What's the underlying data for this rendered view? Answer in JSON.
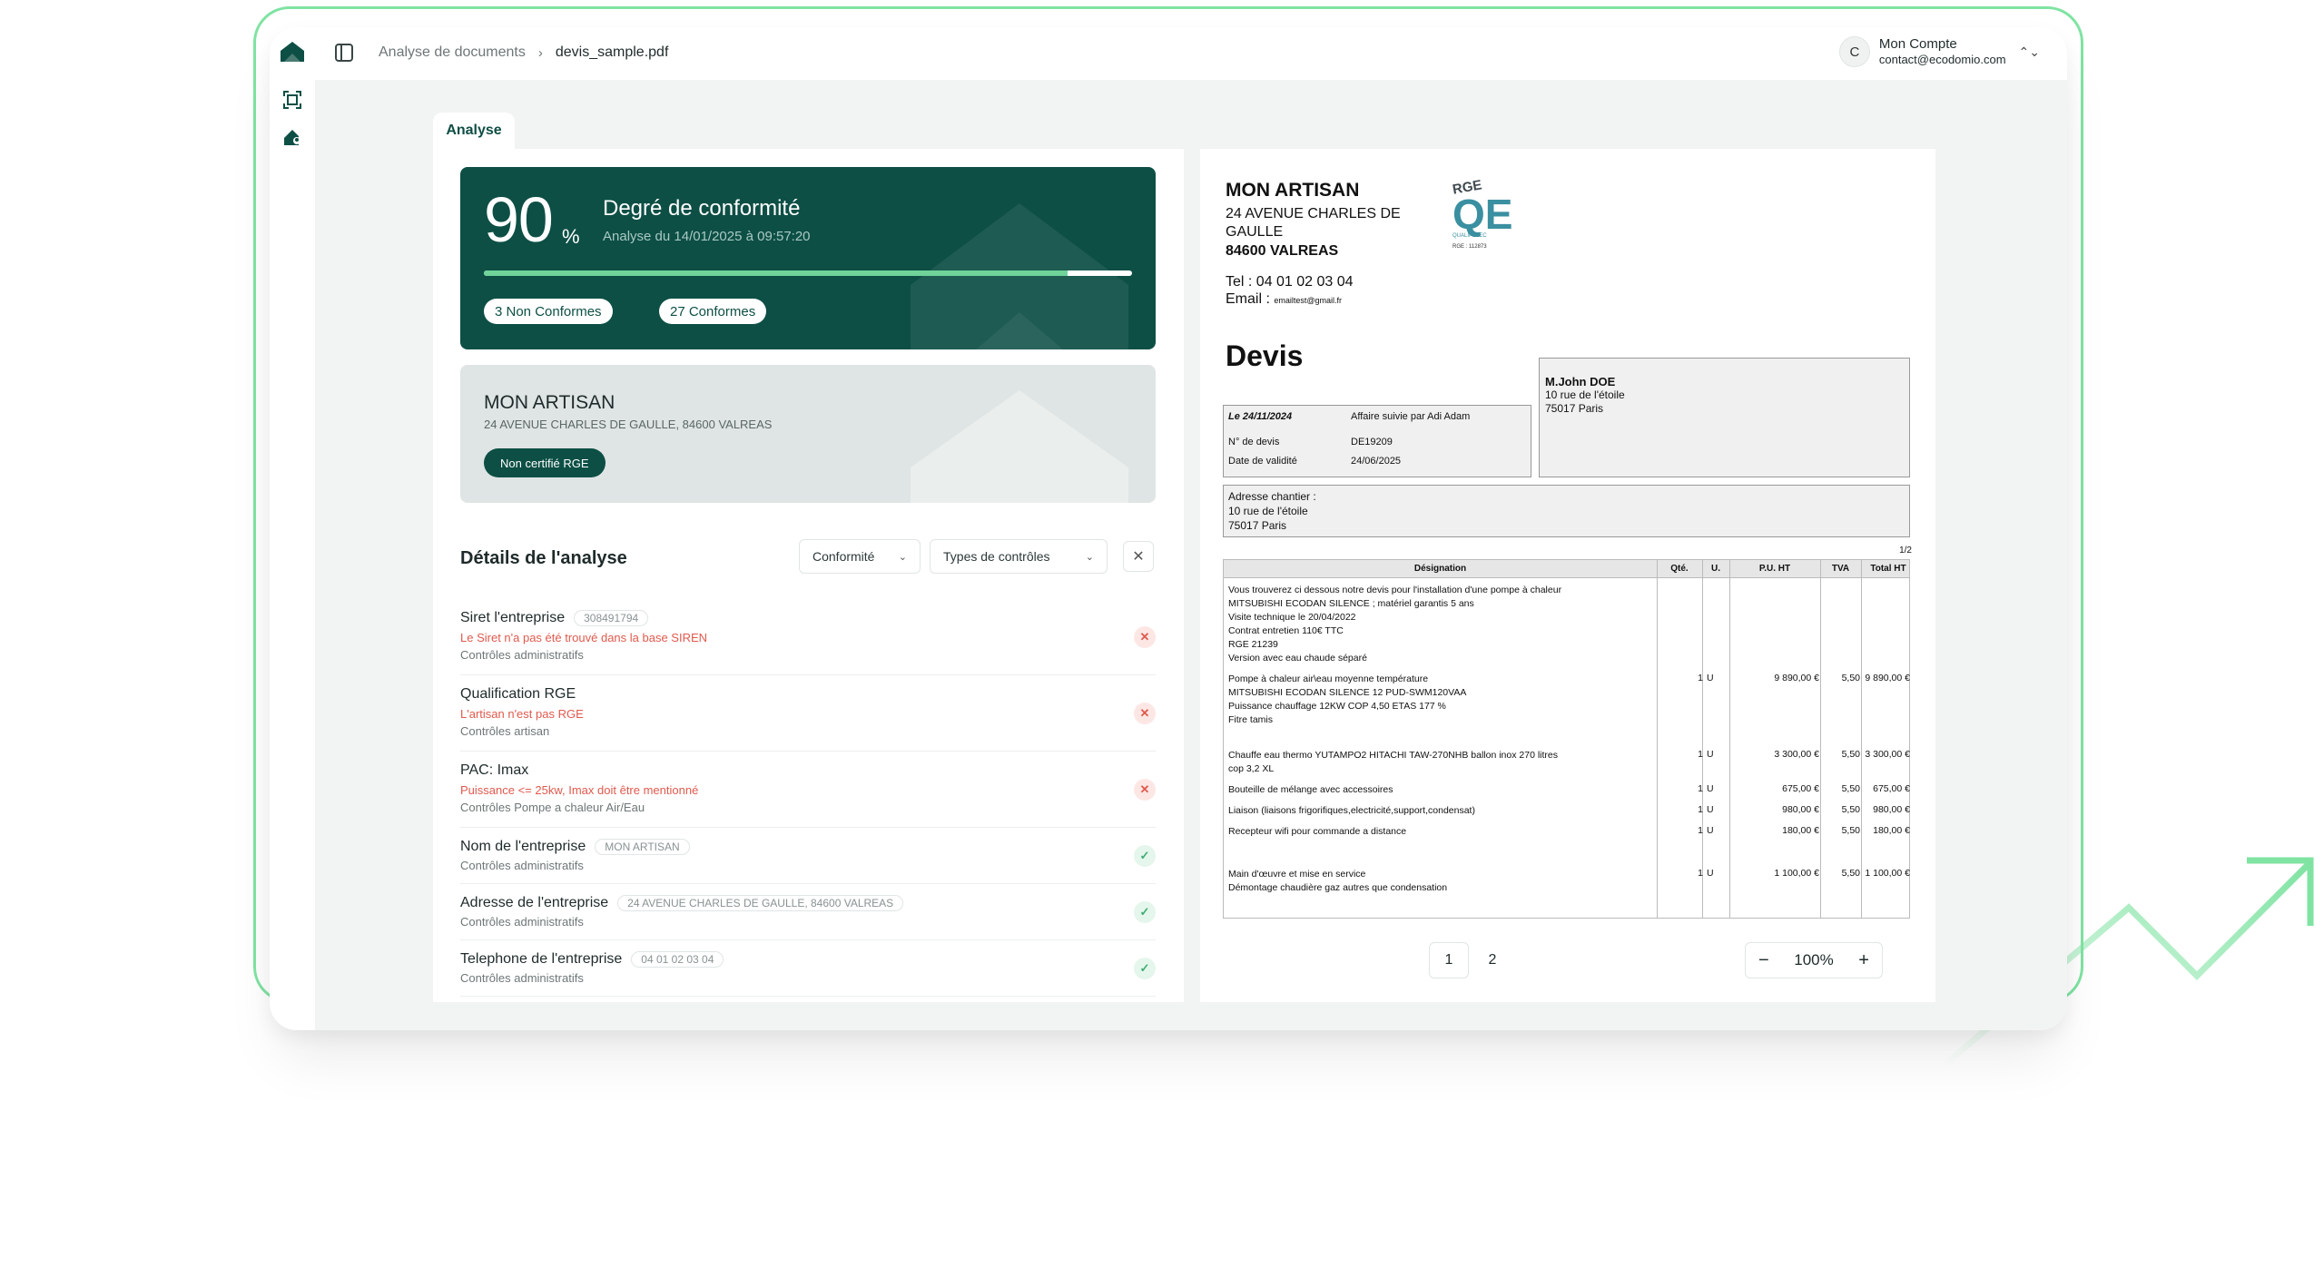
{
  "header": {
    "breadcrumb": [
      "Analyse de documents",
      "devis_sample.pdf"
    ],
    "breadcrumb_sep": "›",
    "account": {
      "initial": "C",
      "name": "Mon Compte",
      "email": "contact@ecodomio.com"
    }
  },
  "tabs": [
    {
      "label": "Analyse",
      "active": true
    }
  ],
  "score": {
    "value": "90",
    "unit": "%",
    "title": "Degré de conformité",
    "date": "Analyse du 14/01/2025 à 09:57:20",
    "progress": 0.9,
    "non_conformes": "3 Non Conformes",
    "conformes": "27 Conformes"
  },
  "artisan": {
    "name": "MON ARTISAN",
    "address": "24 AVENUE CHARLES DE GAULLE, 84600 VALREAS",
    "badge": "Non certifié RGE"
  },
  "details": {
    "title": "Détails de l'analyse",
    "filter_conformite": "Conformité",
    "filter_types": "Types de contrôles",
    "close": "✕",
    "items": [
      {
        "title": "Siret l'entreprise",
        "chip": "308491794",
        "error": "Le Siret n'a pas été trouvé dans la base SIREN",
        "category": "Contrôles administratifs",
        "status": "bad",
        "mark": "✕"
      },
      {
        "title": "Qualification RGE",
        "chip": "",
        "error": "L'artisan n'est pas RGE",
        "category": "Contrôles artisan",
        "status": "bad",
        "mark": "✕"
      },
      {
        "title": "PAC: Imax",
        "chip": "",
        "error": "Puissance <= 25kw, Imax doit être mentionné",
        "category": "Contrôles Pompe a chaleur Air/Eau",
        "status": "bad",
        "mark": "✕"
      },
      {
        "title": "Nom de l'entreprise",
        "chip": "MON ARTISAN",
        "error": "",
        "category": "Contrôles administratifs",
        "status": "ok",
        "mark": "✓"
      },
      {
        "title": "Adresse de l'entreprise",
        "chip": "24 AVENUE CHARLES DE GAULLE, 84600 VALREAS",
        "error": "",
        "category": "Contrôles administratifs",
        "status": "ok",
        "mark": "✓"
      },
      {
        "title": "Telephone de l'entreprise",
        "chip": "04 01 02 03 04",
        "error": "",
        "category": "Contrôles administratifs",
        "status": "ok",
        "mark": "✓"
      }
    ]
  },
  "document": {
    "company": "MON ARTISAN",
    "address": "24 AVENUE CHARLES DE GAULLE",
    "city": "84600 VALREAS",
    "tel": "Tel : 04 01 02 03 04",
    "email_label": "Email :",
    "email": "emailtest@gmail.fr",
    "logo": {
      "rge": "RGE",
      "q": "QE",
      "line1": "QUALIPELEC",
      "line2": "RGE : 112873"
    },
    "title": "Devis",
    "client": {
      "name": "M.John DOE",
      "street": "10 rue de l'étoile",
      "city": "75017 Paris"
    },
    "info": {
      "date": "Le 24/11/2024",
      "affaire": "Affaire suivie par Adi Adam",
      "devis_label": "N° de devis",
      "devis_value": "DE19209",
      "validite_label": "Date de validité",
      "validite_value": "24/06/2025"
    },
    "chantier": {
      "label": "Adresse chantier :",
      "street": "10 rue de l'étoile",
      "city": "75017 Paris"
    },
    "page_indicator": "1/2",
    "table": {
      "headers": [
        "Désignation",
        "Qté.",
        "U.",
        "P.U. HT",
        "TVA",
        "Total HT"
      ],
      "rows": [
        {
          "lines": [
            "Vous trouverez ci dessous notre devis pour l'installation d'une pompe à chaleur",
            "MITSUBISHI ECODAN SILENCE ; matériel garantis 5 ans",
            "Visite technique le 20/04/2022",
            "Contrat entretien 110€ TTC",
            "RGE 21239",
            "Version avec eau chaude séparé"
          ],
          "qte": "",
          "u": "",
          "pu": "",
          "tva": "",
          "total": ""
        },
        {
          "lines": [
            "Pompe à chaleur air\\eau moyenne température",
            "MITSUBISHI ECODAN SILENCE 12 PUD-SWM120VAA",
            "Puissance chauffage 12KW COP 4,50 ETAS 177 %",
            "Fitre tamis"
          ],
          "qte": "1",
          "u": "U",
          "pu": "9 890,00 €",
          "tva": "5,50",
          "total": "9 890,00 €"
        },
        {
          "lines": [
            "Chauffe eau thermo YUTAMPO2 HITACHI TAW-270NHB ballon inox 270 litres",
            "cop 3,2 XL"
          ],
          "qte": "1",
          "u": "U",
          "pu": "3 300,00 €",
          "tva": "5,50",
          "total": "3 300,00 €"
        },
        {
          "lines": [
            "Bouteille de mélange avec accessoires"
          ],
          "qte": "1",
          "u": "U",
          "pu": "675,00 €",
          "tva": "5,50",
          "total": "675,00 €"
        },
        {
          "lines": [
            "Liaison (liaisons frigorifiques,electricité,support,condensat)"
          ],
          "qte": "1",
          "u": "U",
          "pu": "980,00 €",
          "tva": "5,50",
          "total": "980,00 €"
        },
        {
          "lines": [
            "Recepteur wifi pour commande a distance"
          ],
          "qte": "1",
          "u": "U",
          "pu": "180,00 €",
          "tva": "5,50",
          "total": "180,00 €"
        },
        {
          "lines": [
            "Main d'œuvre et mise en service",
            "Démontage chaudière gaz autres que condensation"
          ],
          "qte": "1",
          "u": "U",
          "pu": "1 100,00 €",
          "tva": "5,50",
          "total": "1 100,00 €"
        }
      ]
    },
    "pages": [
      "1",
      "2"
    ],
    "zoom": "100%",
    "zoom_minus": "−",
    "zoom_plus": "+"
  },
  "colors": {
    "brand": "#0d4f45",
    "accent": "#6fd39a",
    "error": "#e05a4d",
    "ok": "#3fae72"
  }
}
